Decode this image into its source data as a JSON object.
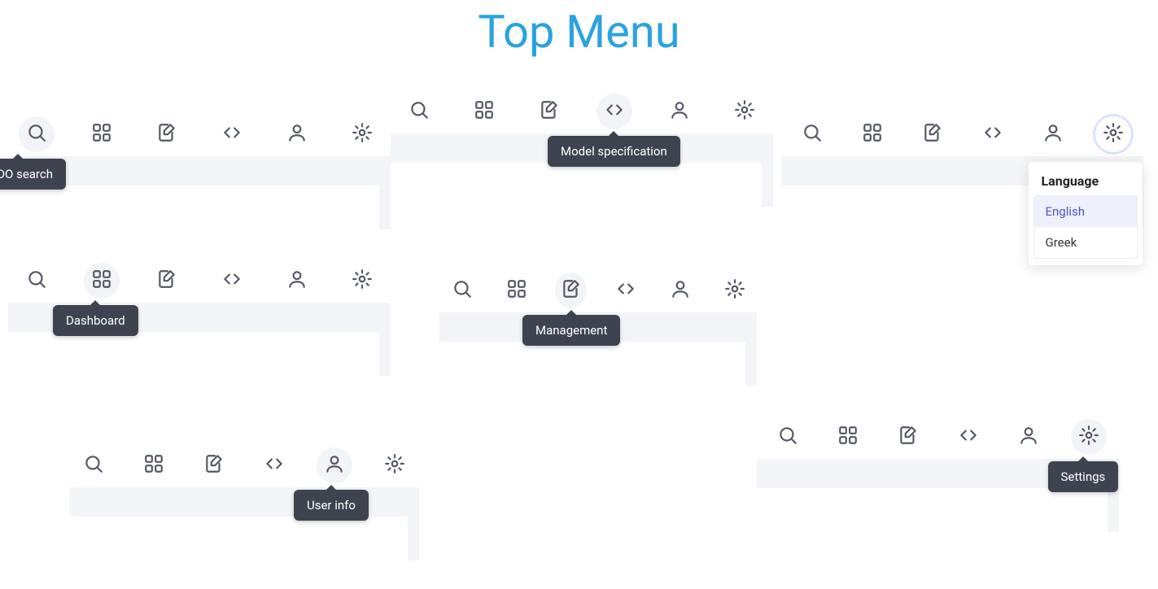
{
  "title": "Top Menu",
  "icons": [
    "search",
    "grid",
    "management",
    "code",
    "user",
    "gear"
  ],
  "tooltips": {
    "search": "SFDO search",
    "grid": "Dashboard",
    "management": "Management",
    "code": "Model specification",
    "user": "User info",
    "gear": "Settings"
  },
  "language_dropdown": {
    "header": "Language",
    "options": [
      "English",
      "Greek"
    ],
    "selected": "English"
  },
  "panels": [
    {
      "id": "p1",
      "active_icon": "search",
      "tooltip_for": "search"
    },
    {
      "id": "p2",
      "active_icon": "code",
      "tooltip_for": "code"
    },
    {
      "id": "p3",
      "active_icon": "gear",
      "focused": true,
      "dropdown": true
    },
    {
      "id": "p4",
      "active_icon": "grid",
      "tooltip_for": "grid"
    },
    {
      "id": "p5",
      "active_icon": "management",
      "tooltip_for": "management"
    },
    {
      "id": "p6",
      "active_icon": "user",
      "tooltip_for": "user"
    },
    {
      "id": "p7",
      "active_icon": "gear",
      "tooltip_for": "gear"
    }
  ]
}
